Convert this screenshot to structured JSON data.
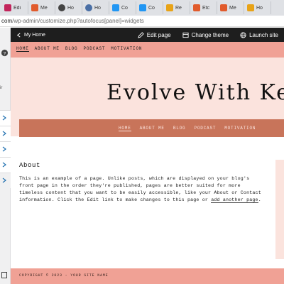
{
  "browser": {
    "tabs": [
      {
        "label": "Edi",
        "color": "#c2255c"
      },
      {
        "label": "Me",
        "color": "#e15b2c"
      },
      {
        "label": "Ho",
        "color": "#444444"
      },
      {
        "label": "Ho",
        "color": "#4a6fa5"
      },
      {
        "label": "Co",
        "color": "#2196f3"
      },
      {
        "label": "Co",
        "color": "#2196f3"
      },
      {
        "label": "Re",
        "color": "#e8a317"
      },
      {
        "label": "Etc",
        "color": "#e15b2c"
      },
      {
        "label": "Me",
        "color": "#e15b2c"
      },
      {
        "label": "Ho",
        "color": "#e8a317"
      }
    ],
    "url_host": "com",
    "url_path": "/wp-admin/customize.php?autofocus[panel]=widgets"
  },
  "sidebar": {
    "cut_text": "ir"
  },
  "wpbar": {
    "home_label": "My Home",
    "edit_label": "Edit page",
    "theme_label": "Change theme",
    "launch_label": "Launch site"
  },
  "topnav": {
    "items": [
      "HOME",
      "ABOUT ME",
      "BLOG",
      "PODCAST",
      "MOTIVATION"
    ]
  },
  "hero": {
    "title": "Evolve With Keki"
  },
  "brownnav": {
    "items": [
      "HOME",
      "ABOUT ME",
      "BLOG",
      "PODCAST",
      "MOTIVATION"
    ]
  },
  "about": {
    "heading": "About",
    "body_1": "This is an example of a page. Unlike posts, which are displayed on your blog's front page in the order they're published, pages are better suited for more timeless content that you want to be easily accessible, like your About or Contact information. Click the Edit link to make changes to this page or ",
    "link": "add another page",
    "body_2": "."
  },
  "footer": {
    "text": "COPYRIGHT © 2023 - YOUR SITE NAME"
  },
  "colors": {
    "salmon": "#f0a195",
    "blush": "#fbe3dd",
    "brown": "#c8745a",
    "wp_dark": "#1e1e1e"
  }
}
